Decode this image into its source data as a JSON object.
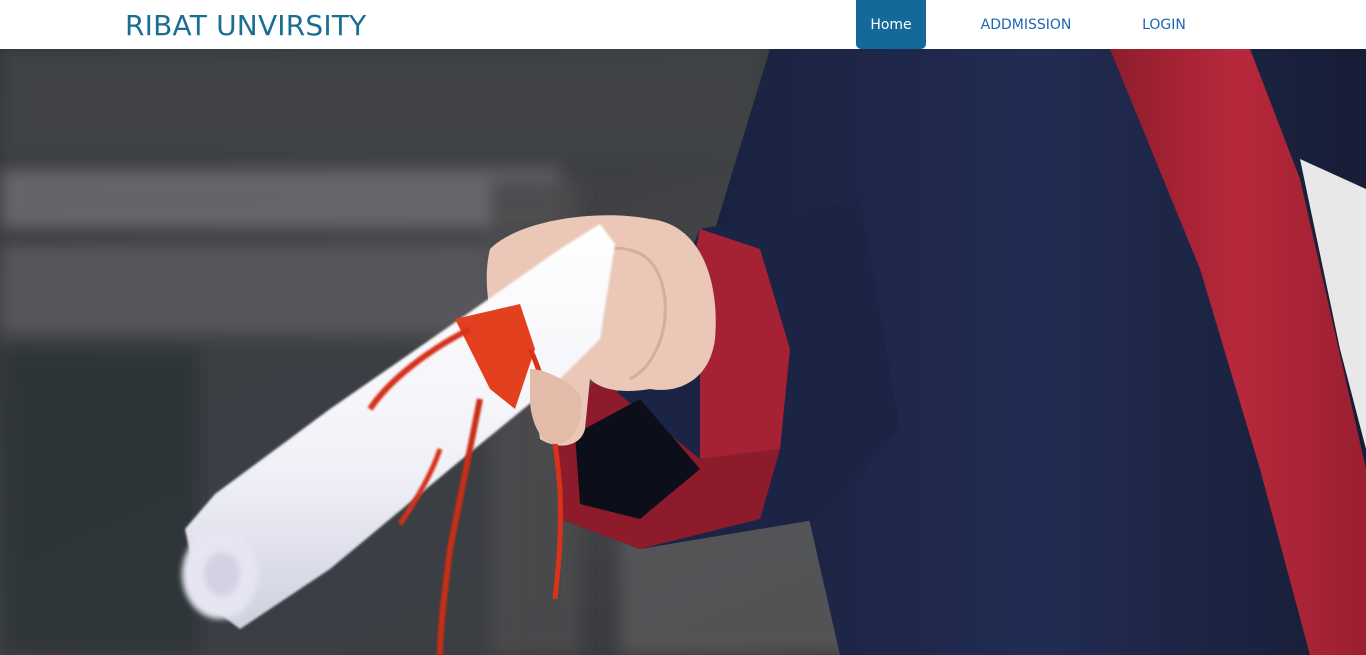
{
  "navbar": {
    "brand": "RIBAT UNVIRSITY",
    "links": [
      {
        "label": "Home",
        "active": true
      },
      {
        "label": "ADDMISSION",
        "active": false
      },
      {
        "label": "LOGIN",
        "active": false
      }
    ]
  },
  "hero": {
    "image": "graduate-holding-diploma-photo"
  },
  "colors": {
    "brand": "#1b6e93",
    "active_nav_bg": "#15699a",
    "nav_link": "#1b67b4"
  }
}
